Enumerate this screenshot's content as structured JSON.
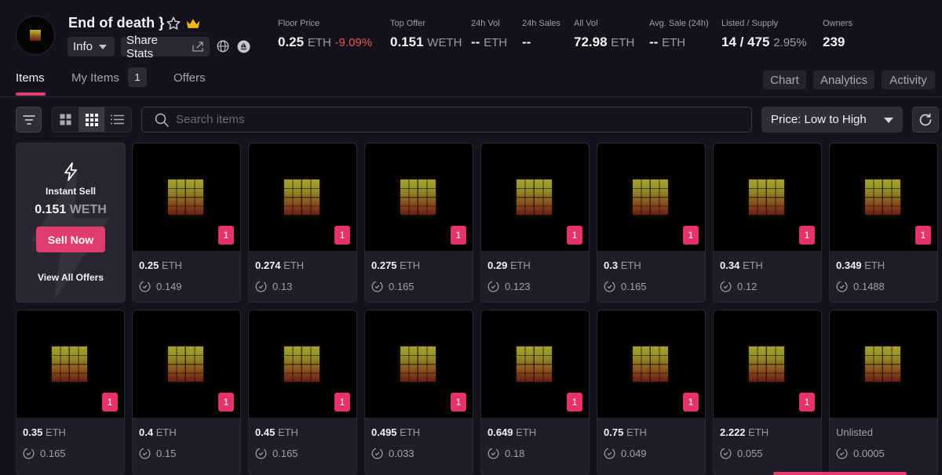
{
  "collection": {
    "name": "End of death }",
    "info_label": "Info",
    "share_label": "Share Stats"
  },
  "stats": [
    {
      "label": "Floor Price",
      "value": "0.25",
      "unit": "ETH",
      "change": "-9.09%"
    },
    {
      "label": "Top Offer",
      "value": "0.151",
      "unit": "WETH"
    },
    {
      "label": "24h Vol",
      "value": "--",
      "unit": "ETH"
    },
    {
      "label": "24h Sales",
      "value": "--"
    },
    {
      "label": "All Vol",
      "value": "72.98",
      "unit": "ETH"
    },
    {
      "label": "Avg. Sale (24h)",
      "value": "--",
      "unit": "ETH"
    },
    {
      "label": "Listed / Supply",
      "value": "14 / 475",
      "extra": "2.95%"
    },
    {
      "label": "Owners",
      "value": "239"
    }
  ],
  "tabs": {
    "items": "Items",
    "my_items": "My Items",
    "my_items_count": "1",
    "offers": "Offers"
  },
  "right_buttons": {
    "chart": "Chart",
    "analytics": "Analytics",
    "activity": "Activity"
  },
  "search": {
    "placeholder": "Search items"
  },
  "sort": {
    "selected": "Price: Low to High"
  },
  "instant_sell": {
    "title": "Instant Sell",
    "value": "0.151",
    "unit": "WETH",
    "button": "Sell Now",
    "view_all": "View All Offers"
  },
  "items": [
    {
      "qty": "1",
      "price": "0.25",
      "unit": "ETH",
      "offer": "0.149"
    },
    {
      "qty": "1",
      "price": "0.274",
      "unit": "ETH",
      "offer": "0.13"
    },
    {
      "qty": "1",
      "price": "0.275",
      "unit": "ETH",
      "offer": "0.165"
    },
    {
      "qty": "1",
      "price": "0.29",
      "unit": "ETH",
      "offer": "0.123"
    },
    {
      "qty": "1",
      "price": "0.3",
      "unit": "ETH",
      "offer": "0.165"
    },
    {
      "qty": "1",
      "price": "0.34",
      "unit": "ETH",
      "offer": "0.12"
    },
    {
      "qty": "1",
      "price": "0.349",
      "unit": "ETH",
      "offer": "0.1488"
    },
    {
      "qty": "1",
      "price": "0.35",
      "unit": "ETH",
      "offer": "0.165"
    },
    {
      "qty": "1",
      "price": "0.4",
      "unit": "ETH",
      "offer": "0.15"
    },
    {
      "qty": "1",
      "price": "0.45",
      "unit": "ETH",
      "offer": "0.165"
    },
    {
      "qty": "1",
      "price": "0.495",
      "unit": "ETH",
      "offer": "0.033"
    },
    {
      "qty": "1",
      "price": "0.649",
      "unit": "ETH",
      "offer": "0.18"
    },
    {
      "qty": "1",
      "price": "0.75",
      "unit": "ETH",
      "offer": "0.049"
    },
    {
      "qty": "1",
      "price": "2.222",
      "unit": "ETH",
      "offer": "0.055"
    },
    {
      "qty": "1",
      "price": "Unlisted",
      "unit": "",
      "offer": "0.0005"
    }
  ],
  "colors": {
    "accent": "#e13c6e",
    "negative": "#e05458",
    "background": "#16121c"
  }
}
